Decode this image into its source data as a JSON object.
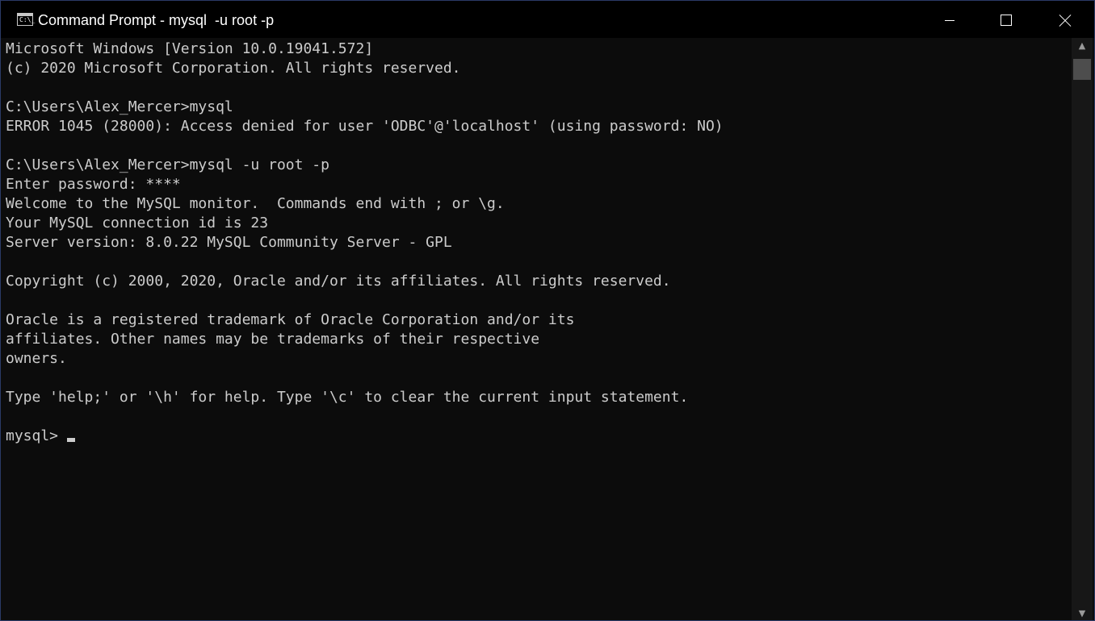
{
  "window": {
    "title": "Command Prompt - mysql  -u root -p",
    "icon": "cmd-app-icon",
    "icon_glyph": "C:\\_",
    "controls": {
      "minimize": "minimize-icon",
      "maximize": "maximize-icon",
      "close": "close-icon"
    }
  },
  "console": {
    "lines": [
      "Microsoft Windows [Version 10.0.19041.572]",
      "(c) 2020 Microsoft Corporation. All rights reserved.",
      "",
      "C:\\Users\\Alex_Mercer>mysql",
      "ERROR 1045 (28000): Access denied for user 'ODBC'@'localhost' (using password: NO)",
      "",
      "C:\\Users\\Alex_Mercer>mysql -u root -p",
      "Enter password: ****",
      "Welcome to the MySQL monitor.  Commands end with ; or \\g.",
      "Your MySQL connection id is 23",
      "Server version: 8.0.22 MySQL Community Server - GPL",
      "",
      "Copyright (c) 2000, 2020, Oracle and/or its affiliates. All rights reserved.",
      "",
      "Oracle is a registered trademark of Oracle Corporation and/or its",
      "affiliates. Other names may be trademarks of their respective",
      "owners.",
      "",
      "Type 'help;' or '\\h' for help. Type '\\c' to clear the current input statement.",
      ""
    ],
    "prompt": "mysql>",
    "text_color": "#cccccc",
    "background_color": "#0c0c0c"
  },
  "scrollbar": {
    "up_icon": "scroll-up-arrow-icon",
    "down_icon": "scroll-down-arrow-icon"
  }
}
